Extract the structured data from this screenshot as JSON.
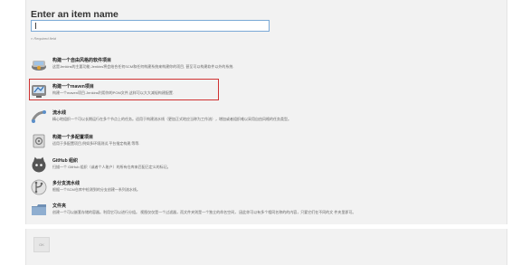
{
  "header": {
    "title": "Enter an item name",
    "input_value": "",
    "required_text": "» Required field"
  },
  "items": [
    {
      "icon": "freestyle-project-icon",
      "label": "构建一个自由风格的软件项目",
      "desc": "这是Jenkins的主要功能.Jenkins将会结合任何SCM和任何构建系统来构建你的项目, 甚至可以构建软件以外的系统."
    },
    {
      "icon": "maven-project-icon",
      "label": "构建一个maven项目",
      "desc": "构建一个maven项目.Jenkins利用你的POM文件,这样可以大大减轻构建配置."
    },
    {
      "icon": "pipeline-icon",
      "label": "流水线",
      "desc": "精心地组织一个可以长期运行在多个节点上的任务。适用于构建流水线（更加正式地应当称为工作流），增加或者组织难以采用自由风格的任务类型。"
    },
    {
      "icon": "multi-config-project-icon",
      "label": "构建一个多配置项目",
      "desc": "适用于多配置项目,例如多环境测试,平台指定构建,等等."
    },
    {
      "icon": "github-org-icon",
      "label": "GitHub 组织",
      "desc": "扫描一个 GitHub 组织（或者个人账户）的所有仓库来匹配已定义的标记。"
    },
    {
      "icon": "multibranch-pipeline-icon",
      "label": "多分支流水线",
      "desc": "根据一个SCM仓库中检测到的分支创建一系列流水线。"
    },
    {
      "icon": "folder-icon",
      "label": "文件夹",
      "desc": "创建一个可以嵌套存储的容器。利用它可以进行分组。 视图仅仅是一个过滤器，而文件夹则是一个独立的命名空间， 因此你可以有多个相同名称的的内容，只要它们在不同的文 件夹里即可。"
    }
  ],
  "footer": {
    "ok_label": "OK"
  },
  "colors": {
    "selection_border": "#d03232",
    "input_border": "#7aa9d6"
  }
}
